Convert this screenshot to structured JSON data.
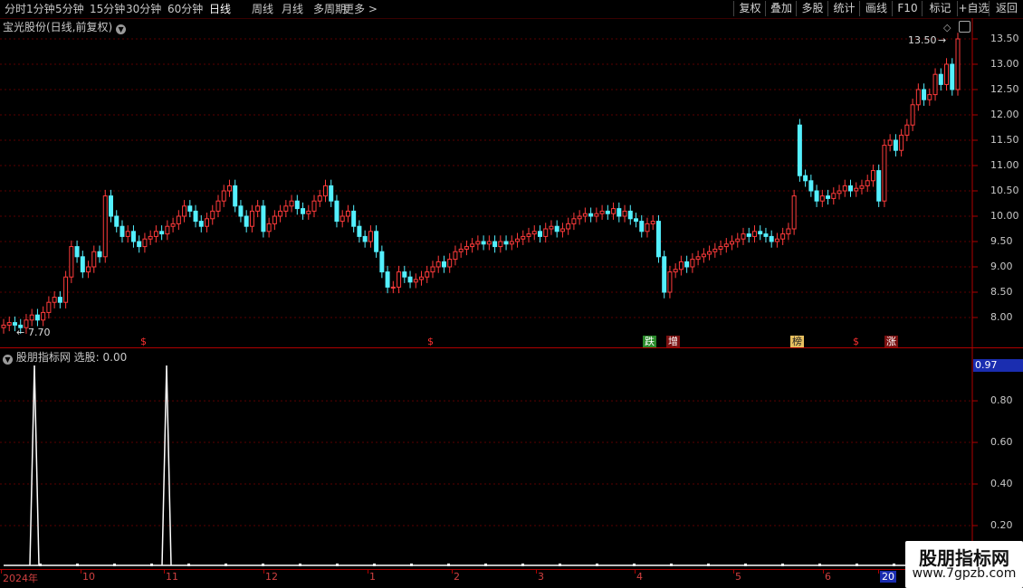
{
  "toolbar": {
    "timeframes": [
      "分时",
      "1分钟",
      "5分钟",
      "15分钟",
      "30分钟",
      "60分钟",
      "日线",
      "周线",
      "月线",
      "多周期",
      "更多 >"
    ],
    "active_timeframe": "日线",
    "right_buttons": [
      "复权",
      "叠加",
      "多股",
      "统计",
      "画线",
      "F10",
      "标记",
      "+自选",
      "返回"
    ]
  },
  "main_chart": {
    "title": "宝光股份(日线,前复权)",
    "y_ticks": [
      "13.50",
      "13.00",
      "12.50",
      "12.00",
      "11.50",
      "11.00",
      "10.50",
      "10.00",
      "9.50",
      "9.00",
      "8.50",
      "8.00"
    ],
    "high_label": "13.50",
    "low_label": "7.70",
    "markers": [
      {
        "text": "$",
        "color": "#ff3030",
        "bg": "transparent"
      },
      {
        "text": "$",
        "color": "#ff3030",
        "bg": "transparent"
      },
      {
        "text": "跌",
        "color": "#ffffff",
        "bg": "#2a8a2a"
      },
      {
        "text": "增",
        "color": "#ffffff",
        "bg": "#7a1010"
      },
      {
        "text": "榜",
        "color": "#202020",
        "bg": "#e8c060"
      },
      {
        "text": "$",
        "color": "#ff3030",
        "bg": "transparent"
      },
      {
        "text": "涨",
        "color": "#ffffff",
        "bg": "#7a1010"
      }
    ]
  },
  "indicator": {
    "title": "股朋指标网  选股: 0.00",
    "y_ticks": [
      "0.80",
      "0.60",
      "0.40",
      "0.20"
    ],
    "current_value": "0.97"
  },
  "x_axis": {
    "labels": [
      "2024年",
      "10",
      "11",
      "12",
      "1",
      "2",
      "3",
      "4",
      "5",
      "6",
      "20"
    ]
  },
  "watermark": {
    "name": "股朋指标网",
    "url": "www.7gpzb.com"
  },
  "colors": {
    "up": "#ff3b3b",
    "down": "#54f0ff",
    "axis": "#b00000",
    "background": "#000000"
  },
  "chart_data": {
    "type": "candlestick",
    "title": "宝光股份(日线,前复权)",
    "ylim": [
      7.6,
      13.8
    ],
    "close": [
      7.85,
      7.9,
      7.85,
      7.8,
      7.95,
      8.05,
      7.95,
      8.1,
      8.3,
      8.4,
      8.3,
      8.8,
      9.4,
      9.2,
      8.9,
      9.0,
      9.3,
      9.2,
      10.4,
      10.0,
      9.8,
      9.6,
      9.7,
      9.5,
      9.4,
      9.55,
      9.6,
      9.7,
      9.65,
      9.8,
      9.85,
      10.0,
      10.2,
      10.1,
      9.9,
      9.8,
      9.95,
      10.1,
      10.3,
      10.5,
      10.6,
      10.2,
      10.0,
      9.8,
      10.1,
      10.2,
      9.7,
      9.85,
      10.0,
      10.1,
      10.2,
      10.3,
      10.15,
      10.05,
      10.1,
      10.3,
      10.4,
      10.6,
      10.3,
      9.9,
      10.0,
      10.1,
      9.8,
      9.6,
      9.5,
      9.7,
      9.3,
      8.9,
      8.6,
      8.6,
      8.9,
      8.8,
      8.7,
      8.75,
      8.8,
      8.9,
      9.0,
      9.1,
      9.0,
      9.15,
      9.3,
      9.35,
      9.4,
      9.45,
      9.5,
      9.45,
      9.5,
      9.4,
      9.5,
      9.45,
      9.5,
      9.55,
      9.6,
      9.65,
      9.7,
      9.6,
      9.75,
      9.8,
      9.7,
      9.75,
      9.85,
      9.95,
      10.0,
      10.05,
      10.0,
      10.05,
      10.1,
      10.05,
      10.15,
      10.0,
      10.1,
      9.95,
      9.9,
      9.7,
      9.85,
      9.9,
      9.2,
      8.5,
      8.9,
      8.95,
      9.1,
      9.0,
      9.15,
      9.2,
      9.25,
      9.3,
      9.35,
      9.4,
      9.45,
      9.5,
      9.55,
      9.65,
      9.6,
      9.7,
      9.65,
      9.6,
      9.5,
      9.55,
      9.65,
      9.75,
      10.4,
      10.8,
      10.7,
      10.5,
      10.3,
      10.4,
      10.35,
      10.45,
      10.5,
      10.6,
      10.5,
      10.55,
      10.6,
      10.7,
      10.9,
      10.3,
      11.4,
      11.5,
      11.3,
      11.6,
      11.8,
      12.2,
      12.5,
      12.3,
      12.4,
      12.8,
      12.6,
      13.0,
      12.5,
      13.5
    ],
    "open": [
      7.8,
      7.85,
      7.9,
      7.85,
      7.8,
      7.95,
      8.05,
      7.95,
      8.1,
      8.3,
      8.4,
      8.3,
      8.8,
      9.4,
      9.2,
      8.9,
      9.0,
      9.3,
      9.2,
      10.4,
      10.0,
      9.8,
      9.6,
      9.7,
      9.5,
      9.4,
      9.55,
      9.6,
      9.7,
      9.65,
      9.8,
      9.85,
      10.0,
      10.2,
      10.1,
      9.9,
      9.8,
      9.95,
      10.1,
      10.3,
      10.5,
      10.6,
      10.2,
      10.0,
      9.8,
      10.1,
      10.2,
      9.7,
      9.85,
      10.0,
      10.1,
      10.2,
      10.3,
      10.15,
      10.05,
      10.1,
      10.3,
      10.4,
      10.6,
      10.3,
      9.9,
      10.0,
      10.1,
      9.8,
      9.6,
      9.5,
      9.7,
      9.3,
      8.9,
      8.6,
      8.6,
      8.9,
      8.8,
      8.7,
      8.75,
      8.8,
      8.9,
      9.0,
      9.1,
      9.0,
      9.15,
      9.3,
      9.35,
      9.4,
      9.45,
      9.5,
      9.45,
      9.5,
      9.4,
      9.5,
      9.45,
      9.5,
      9.55,
      9.6,
      9.65,
      9.7,
      9.6,
      9.75,
      9.8,
      9.7,
      9.75,
      9.85,
      9.95,
      10.0,
      10.05,
      10.0,
      10.05,
      10.1,
      10.05,
      10.15,
      10.0,
      10.1,
      9.95,
      9.9,
      9.7,
      9.85,
      9.9,
      9.2,
      8.5,
      8.9,
      8.95,
      9.1,
      9.0,
      9.15,
      9.2,
      9.25,
      9.3,
      9.35,
      9.4,
      9.45,
      9.5,
      9.55,
      9.65,
      9.6,
      9.7,
      9.65,
      9.6,
      9.5,
      9.55,
      9.65,
      9.75,
      11.8,
      10.8,
      10.7,
      10.5,
      10.3,
      10.4,
      10.35,
      10.45,
      10.5,
      10.6,
      10.5,
      10.55,
      10.6,
      10.7,
      10.9,
      10.3,
      11.4,
      11.5,
      11.3,
      11.6,
      11.8,
      12.2,
      12.5,
      12.3,
      12.4,
      12.8,
      12.6,
      13.0,
      12.5
    ]
  }
}
